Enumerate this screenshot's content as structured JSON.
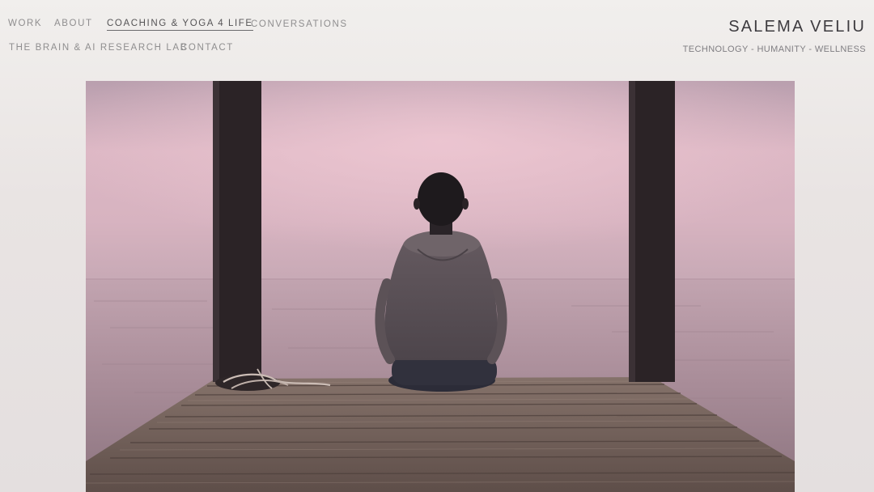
{
  "nav": {
    "row1": [
      {
        "label": "WORK",
        "active": false
      },
      {
        "label": "ABOUT",
        "active": false
      },
      {
        "label": "COACHING & YOGA 4 LIFE",
        "active": true
      },
      {
        "label": "CONVERSATIONS",
        "active": false
      }
    ],
    "row2": [
      {
        "label": "THE BRAIN & AI RESEARCH LAB",
        "active": false
      },
      {
        "label": "CONTACT",
        "active": false
      }
    ]
  },
  "site": {
    "title": "SALEMA VELIU",
    "tagline": "TECHNOLOGY - HUMANITY - WELLNESS"
  },
  "hero": {
    "colors": {
      "sky_top": "#bfa3b2",
      "sky_mid": "#e4bcc8",
      "horizon": "#c9aab6",
      "water": "#a58a96",
      "dock": "#6d5b55",
      "posts": "#2b2326"
    }
  }
}
